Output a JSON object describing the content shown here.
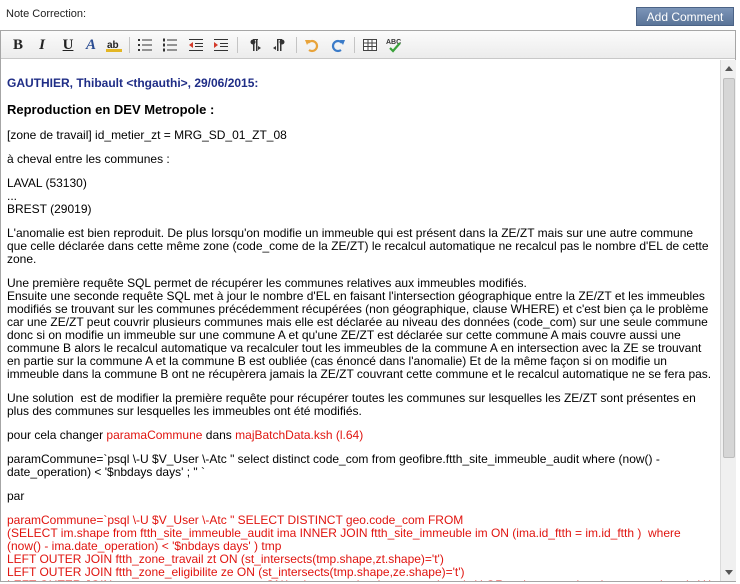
{
  "header": {
    "note_label": "Note Correction:",
    "add_button": "Add Comment"
  },
  "toolbar": {
    "buttons": [
      "bold-icon",
      "italic-icon",
      "underline-icon",
      "font-color-icon",
      "highlight-icon",
      "bullet-list-icon",
      "numbered-list-icon",
      "outdent-icon",
      "indent-icon",
      "ltr-icon",
      "rtl-icon",
      "undo-icon",
      "redo-icon",
      "table-icon",
      "spellcheck-icon"
    ],
    "colors": {
      "undo": "#e8a33a",
      "redo": "#3b7bc8",
      "spell_check": "#3aa13a",
      "link_red": "#e0140f",
      "author_blue": "#1f2d86"
    }
  },
  "content": {
    "author": "GAUTHIER, Thibault <thgauthi>, 29/06/2015:",
    "heading": "Reproduction en DEV Metropole :",
    "zone": "[zone de travail] id_metier_zt = MRG_SD_01_ZT_08",
    "cheval": "à cheval entre les communes :",
    "commune1": "LAVAL (53130)",
    "ellipsis": "...",
    "commune2": "BREST (29019)",
    "para1": "L'anomalie est bien reproduit. De plus lorsqu'on modifie un immeuble qui est présent dans la ZE/ZT mais sur une autre commune que celle déclarée dans cette même zone (code_come de la ZE/ZT) le recalcul automatique ne recalcul pas le nombre d'EL de cette zone.",
    "para2": "Une première requête SQL permet de récupérer les communes relatives aux immeubles modifiés.\nEnsuite une seconde requête SQL met à jour le nombre d'EL en faisant l'intersection géographique entre la ZE/ZT et les immeubles modifiés se trouvant sur les communes précédemment récupérées (non géographique, clause WHERE) et c'est bien ça le problème car une ZE/ZT peut couvrir plusieurs communes mais elle est déclarée au niveau des données (code_com) sur une seule commune donc si on modifie un immeuble sur une commune A et qu'une ZE/ZT est déclarée sur cette commune A mais couvre aussi une commune B alors le recalcul automatique va recalculer tout les immeubles de la commune A en intersection avec la ZE se trouvant en partie sur la commune A et la commune B est oubliée (cas énoncé dans l'anomalie) Et de la même façon si on modifie un immeuble dans la commune B ont ne récupèrera jamais la ZE/ZT couvrant cette commune et le recalcul automatique ne se fera pas.",
    "para3": "Une solution  est de modifier la première requête pour récupérer toutes les communes sur lesquelles les ZE/ZT sont présentes en plus des communes sur lesquelles les immeubles ont été modifiés.",
    "change_prefix": "pour cela changer ",
    "change_var": "paramaCommune",
    "change_mid": " dans ",
    "change_file": "majBatchData.ksh (l.64)",
    "old_code": "paramCommune=`psql \\-U $V_User \\-Atc \" select distinct code_com from geofibre.ftth_site_immeuble_audit where (now() - date_operation) < '$nbdays days' ; \" `",
    "par": "par",
    "new_code": "paramCommune=`psql \\-U $V_User \\-Atc \" SELECT DISTINCT geo.code_com FROM\n(SELECT im.shape from ftth_site_immeuble_audit ima INNER JOIN ftth_site_immeuble im ON (ima.id_ftth = im.id_ftth )  where (now() - ima.date_operation) < '$nbdays days' ) tmp\nLEFT OUTER JOIN ftth_zone_travail zt ON (st_intersects(tmp.shape,zt.shape)='t')\nLEFT OUTER JOIN ftth_zone_eligibilite ze ON (st_intersects(tmp.shape,ze.shape)='t')\nLEFT OUTER JOIN car_georoutecommune geo ON(st_intersects(zt.shape,geo.shape)='t' OR st_intersects(ze.shape,geo.shape)='t' ) ORDER BY"
  }
}
